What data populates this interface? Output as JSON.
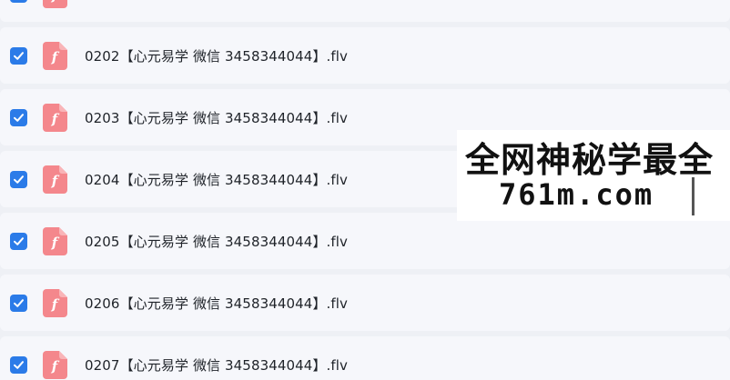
{
  "file_list": {
    "rows": [
      {
        "name": "",
        "checked": true,
        "icon": "flash-file-icon"
      },
      {
        "name": "0202【心元易学 微信 3458344044】.flv",
        "checked": true,
        "icon": "flash-file-icon"
      },
      {
        "name": "0203【心元易学 微信 3458344044】.flv",
        "checked": true,
        "icon": "flash-file-icon"
      },
      {
        "name": "0204【心元易学 微信 3458344044】.flv",
        "checked": true,
        "icon": "flash-file-icon"
      },
      {
        "name": "0205【心元易学 微信 3458344044】.flv",
        "checked": true,
        "icon": "flash-file-icon"
      },
      {
        "name": "0206【心元易学 微信 3458344044】.flv",
        "checked": true,
        "icon": "flash-file-icon"
      },
      {
        "name": "0207【心元易学 微信 3458344044】.flv",
        "checked": true,
        "icon": "flash-file-icon"
      }
    ]
  },
  "watermark": {
    "line1": "全网神秘学最全",
    "line2": "761m.com"
  },
  "colors": {
    "checkbox": "#2b7be8",
    "file_icon": "#f4878c",
    "row_background": "#f6f7fb",
    "text": "#1f2329"
  }
}
